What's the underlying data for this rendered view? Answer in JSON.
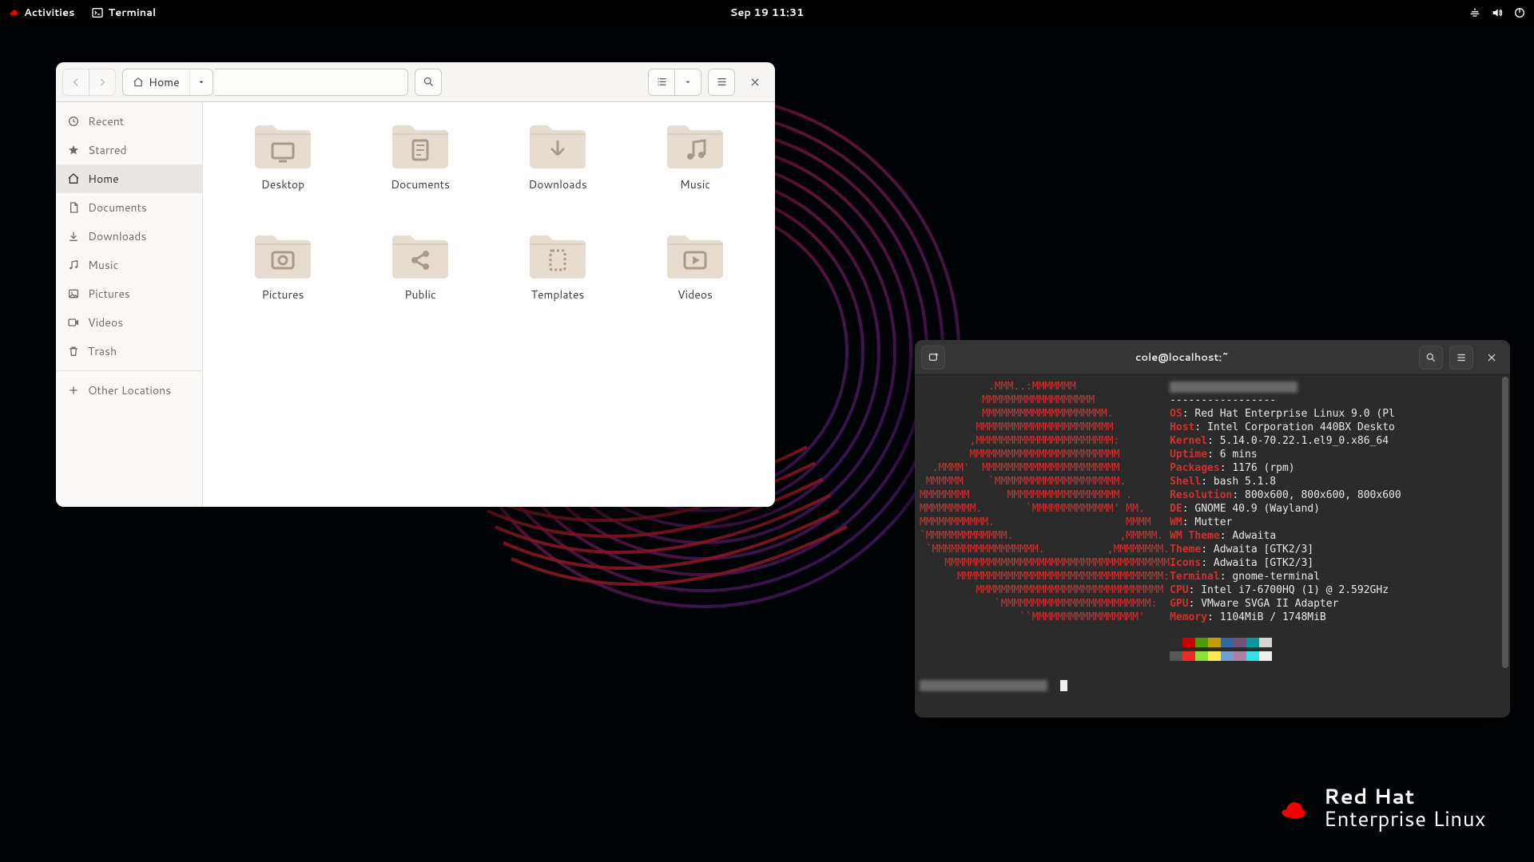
{
  "topbar": {
    "activities": "Activities",
    "app_name": "Terminal",
    "datetime": "Sep 19  11:31"
  },
  "brand": {
    "line1": "Red Hat",
    "line2": "Enterprise Linux"
  },
  "files": {
    "path_label": "Home",
    "sidebar": [
      {
        "id": "recent",
        "label": "Recent",
        "icon": "clock"
      },
      {
        "id": "starred",
        "label": "Starred",
        "icon": "star"
      },
      {
        "id": "home",
        "label": "Home",
        "icon": "home",
        "active": true
      },
      {
        "id": "documents",
        "label": "Documents",
        "icon": "doc"
      },
      {
        "id": "downloads",
        "label": "Downloads",
        "icon": "down"
      },
      {
        "id": "music",
        "label": "Music",
        "icon": "music"
      },
      {
        "id": "pictures",
        "label": "Pictures",
        "icon": "pic"
      },
      {
        "id": "videos",
        "label": "Videos",
        "icon": "video"
      },
      {
        "id": "trash",
        "label": "Trash",
        "icon": "trash"
      },
      {
        "id": "other",
        "label": "Other Locations",
        "icon": "plus",
        "sep_before": true
      }
    ],
    "folders": [
      {
        "label": "Desktop",
        "glyph": "desktop"
      },
      {
        "label": "Documents",
        "glyph": "doc"
      },
      {
        "label": "Downloads",
        "glyph": "down"
      },
      {
        "label": "Music",
        "glyph": "music"
      },
      {
        "label": "Pictures",
        "glyph": "pic"
      },
      {
        "label": "Public",
        "glyph": "share"
      },
      {
        "label": "Templates",
        "glyph": "tmpl"
      },
      {
        "label": "Videos",
        "glyph": "video"
      }
    ]
  },
  "terminal": {
    "title": "cole@localhost:~",
    "ascii": [
      "           .MMM..:MMMMMMM",
      "          MMMMMMMMMMMMMMMMMM",
      "          MMMMMMMMMMMMMMMMMMMM.",
      "         MMMMMMMMMMMMMMMMMMMMMM",
      "        ,MMMMMMMMMMMMMMMMMMMMMM:",
      "        MMMMMMMMMMMMMMMMMMMMMMMM",
      "  .MMMM'  MMMMMMMMMMMMMMMMMMMMMM",
      " MMMMMM    `MMMMMMMMMMMMMMMMMMMM.",
      "MMMMMMMM      MMMMMMMMMMMMMMMMMM .",
      "MMMMMMMMM.       `MMMMMMMMMMMMM' MM.",
      "MMMMMMMMMMM.                     MMMM",
      "`MMMMMMMMMMMMM.                 ,MMMMM.",
      " `MMMMMMMMMMMMMMMMM.          ,MMMMMMMM.",
      "    MMMMMMMMMMMMMMMMMMMMMMMMMMMMMMMMMMMM",
      "      MMMMMMMMMMMMMMMMMMMMMMMMMMMMMMMMM:",
      "         MMMMMMMMMMMMMMMMMMMMMMMMMMMMMM",
      "            `MMMMMMMMMMMMMMMMMMMMMMMM:",
      "                ``MMMMMMMMMMMMMMMMM'"
    ],
    "info": [
      {
        "key": "",
        "val": "-----------------"
      },
      {
        "key": "OS",
        "val": "Red Hat Enterprise Linux 9.0 (Pl"
      },
      {
        "key": "Host",
        "val": "Intel Corporation 440BX Deskto"
      },
      {
        "key": "Kernel",
        "val": "5.14.0-70.22.1.el9_0.x86_64"
      },
      {
        "key": "Uptime",
        "val": "6 mins"
      },
      {
        "key": "Packages",
        "val": "1176 (rpm)"
      },
      {
        "key": "Shell",
        "val": "bash 5.1.8"
      },
      {
        "key": "Resolution",
        "val": "800x600, 800x600, 800x600"
      },
      {
        "key": "DE",
        "val": "GNOME 40.9 (Wayland)"
      },
      {
        "key": "WM",
        "val": "Mutter"
      },
      {
        "key": "WM Theme",
        "val": "Adwaita"
      },
      {
        "key": "Theme",
        "val": "Adwaita [GTK2/3]"
      },
      {
        "key": "Icons",
        "val": "Adwaita [GTK2/3]"
      },
      {
        "key": "Terminal",
        "val": "gnome-terminal"
      },
      {
        "key": "CPU",
        "val": "Intel i7-6700HQ (1) @ 2.592GHz"
      },
      {
        "key": "GPU",
        "val": "VMware SVGA II Adapter"
      },
      {
        "key": "Memory",
        "val": "1104MiB / 1748MiB"
      }
    ],
    "swatches_top": [
      "#2e2e2e",
      "#cc0000",
      "#4e9a06",
      "#c4a000",
      "#3465a4",
      "#75507b",
      "#06989a",
      "#d3d7cf"
    ],
    "swatches_bottom": [
      "#555753",
      "#ef2929",
      "#8ae234",
      "#fce94f",
      "#729fcf",
      "#ad7fa8",
      "#34e2e2",
      "#eeeeec"
    ]
  }
}
